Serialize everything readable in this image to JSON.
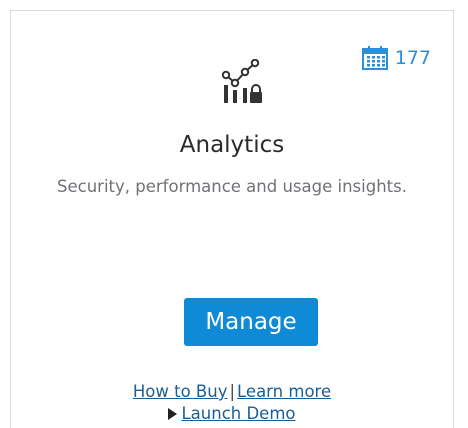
{
  "card": {
    "title": "Analytics",
    "subtitle": "Security, performance and usage insights.",
    "icon": "analytics-chart-lock-icon",
    "badge": {
      "icon": "calendar-icon",
      "count": "177",
      "color": "#2f8fd6"
    },
    "manage_button": {
      "label": "Manage",
      "color": "#0e8ad6"
    },
    "links": {
      "how_to_buy": "How to Buy",
      "separator": "|",
      "learn_more": "Learn more",
      "launch_demo": "Launch Demo"
    }
  }
}
